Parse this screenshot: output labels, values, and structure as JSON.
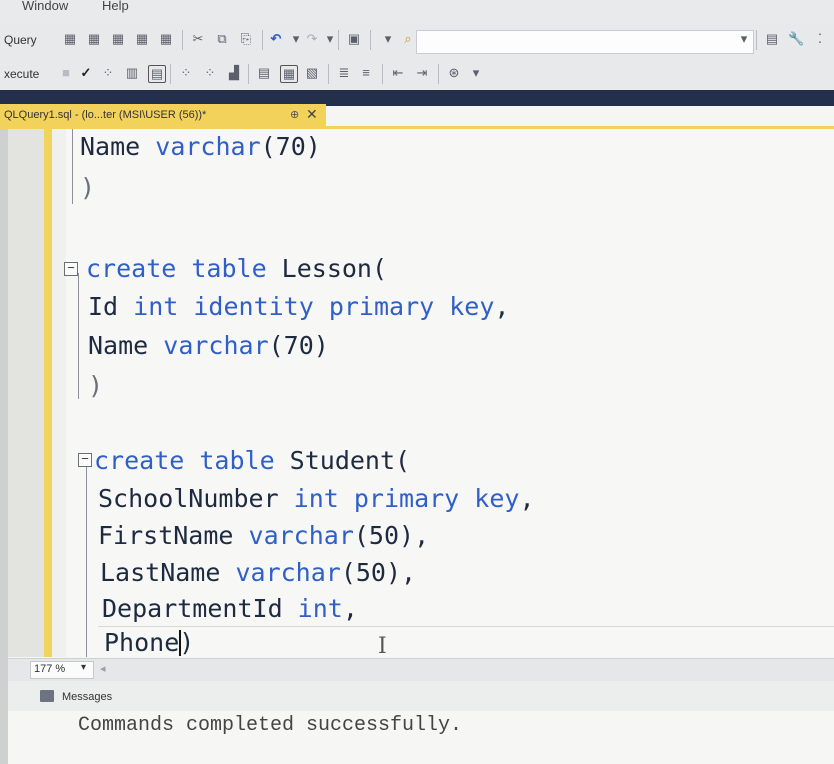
{
  "menu": {
    "window": "Window",
    "help": "Help"
  },
  "toolbar1": {
    "query_label": "Query"
  },
  "toolbar2": {
    "execute_label": "xecute"
  },
  "tab": {
    "title": "QLQuery1.sql - (lo...ter (MSI\\USER (56))*",
    "pin": "⊕",
    "close": "✕"
  },
  "code": {
    "l1": {
      "a": "Name ",
      "b": "varchar",
      "c": "(70)"
    },
    "l2": ")",
    "l4": {
      "a": "create table ",
      "b": "Lesson("
    },
    "l5": {
      "a": "Id ",
      "b": "int identity primary key",
      "c": ","
    },
    "l6": {
      "a": "Name ",
      "b": "varchar",
      "c": "(70)"
    },
    "l7": ")",
    "l9": {
      "a": "create table ",
      "b": "Student("
    },
    "l10": {
      "a": "SchoolNumber ",
      "b": "int primary key",
      "c": ","
    },
    "l11": {
      "a": "FirstName ",
      "b": "varchar",
      "c": "(50),"
    },
    "l12": {
      "a": "LastName ",
      "b": "varchar",
      "c": "(50),"
    },
    "l13": {
      "a": "DepartmentId ",
      "b": "int",
      "c": ","
    },
    "l14": {
      "a": "Phone",
      "b": ")"
    }
  },
  "zoom": {
    "value": "177 %"
  },
  "messages": {
    "tab_label": "Messages",
    "text": "Commands completed successfully."
  },
  "colors": {
    "keyword": "#2f5fc7",
    "tab_accent": "#f3d25b",
    "dark_bar": "#232f4b"
  }
}
